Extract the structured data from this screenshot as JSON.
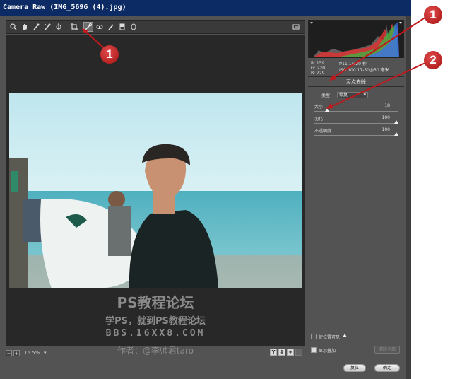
{
  "window": {
    "title": "Camera Raw (IMG_5696 (4).jpg)"
  },
  "toolbar": {
    "tools": [
      "zoom-icon",
      "hand-icon",
      "white-balance-icon",
      "color-sampler-icon",
      "target-adjust-icon",
      "crop-icon",
      "spot-removal-icon",
      "red-eye-icon",
      "adjustment-brush-icon",
      "graduated-filter-icon",
      "radial-filter-icon"
    ],
    "active_tool": "spot-removal-icon"
  },
  "watermark": {
    "line1": "PS教程论坛",
    "line2": "学PS，就到PS教程论坛",
    "line3": "BBS.16XX8.COM",
    "line4": "作者：@李帅君taro"
  },
  "bottom": {
    "zoom": "16.5%"
  },
  "info": {
    "r": "R:  159",
    "g": "G:  220",
    "b": "B:  229",
    "exposure": "f/11   1/320 秒",
    "iso": "ISO 100   17-50@50 毫米"
  },
  "panel": {
    "title": "污点去除",
    "type_label": "类型：",
    "type_value": "修复",
    "sliders": [
      {
        "label": "大小",
        "value": "18",
        "level": 0.15
      },
      {
        "label": "羽化",
        "value": "100",
        "level": 1.0
      },
      {
        "label": "不透明度",
        "value": "100",
        "level": 1.0
      }
    ],
    "visualize_label": "使位置可见",
    "overlay_label": "显示叠加",
    "clear_all": "清除全部",
    "reset": "复位",
    "ok": "确定"
  },
  "callouts": {
    "one": "1",
    "two": "2"
  },
  "colors": {
    "accent_red": "#c0181c",
    "panel_bg": "#535353",
    "titlebar": "#0c2a63"
  }
}
